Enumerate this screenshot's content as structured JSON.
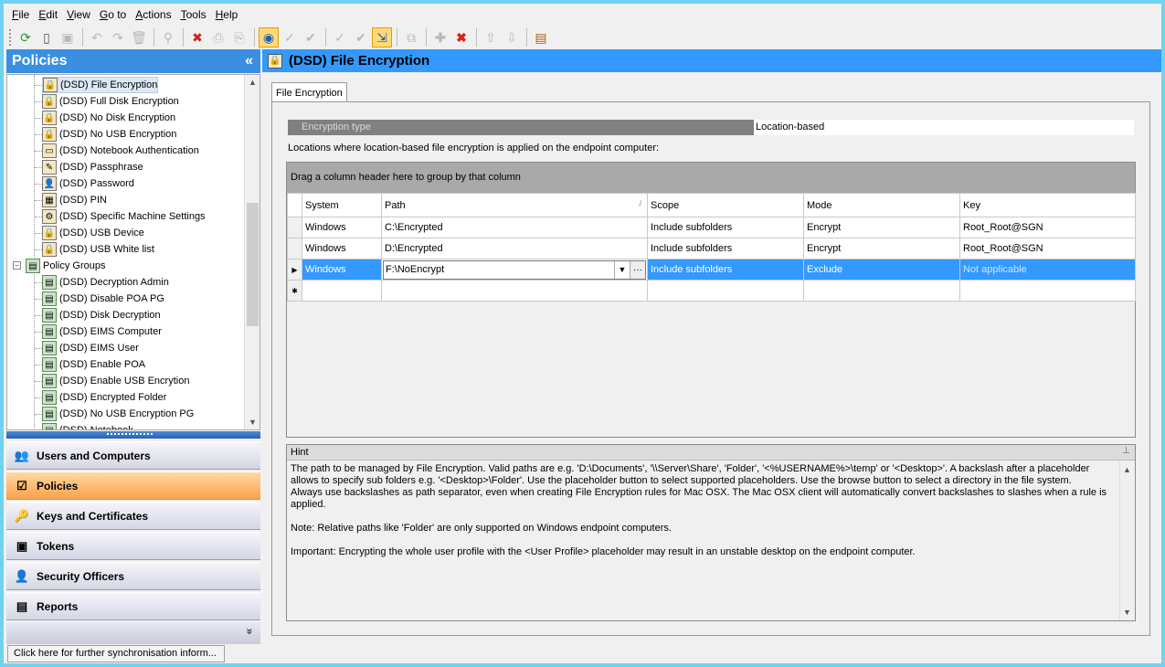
{
  "menu": [
    {
      "pre": "",
      "ul": "F",
      "post": "ile"
    },
    {
      "pre": "",
      "ul": "E",
      "post": "dit"
    },
    {
      "pre": "",
      "ul": "V",
      "post": "iew"
    },
    {
      "pre": "",
      "ul": "G",
      "post": "o to"
    },
    {
      "pre": "",
      "ul": "A",
      "post": "ctions"
    },
    {
      "pre": "",
      "ul": "T",
      "post": "ools"
    },
    {
      "pre": "",
      "ul": "H",
      "post": "elp"
    }
  ],
  "left": {
    "title": "Policies",
    "collapse_glyph": "«",
    "tree": [
      {
        "label": "(DSD) File Encryption",
        "icon": "lock-doc-icon",
        "selected": true
      },
      {
        "label": "(DSD) Full Disk Encryption",
        "icon": "lock-doc-icon"
      },
      {
        "label": "(DSD) No Disk Encryption",
        "icon": "lock-doc-icon"
      },
      {
        "label": "(DSD) No USB Encryption",
        "icon": "lock-doc-icon"
      },
      {
        "label": "(DSD) Notebook Authentication",
        "icon": "notebook-icon"
      },
      {
        "label": "(DSD) Passphrase",
        "icon": "passphrase-icon"
      },
      {
        "label": "(DSD) Password",
        "icon": "user-key-icon"
      },
      {
        "label": "(DSD) PIN",
        "icon": "pin-icon"
      },
      {
        "label": "(DSD) Specific Machine Settings",
        "icon": "machine-icon"
      },
      {
        "label": "(DSD) USB Device",
        "icon": "lock-doc-icon"
      },
      {
        "label": "(DSD) USB White list",
        "icon": "lock-doc-icon"
      },
      {
        "label": "Policy Groups",
        "icon": "policy-group-icon",
        "group": true
      },
      {
        "label": "(DSD) Decryption Admin",
        "icon": "policy-group-icon"
      },
      {
        "label": "(DSD) Disable POA PG",
        "icon": "policy-group-icon"
      },
      {
        "label": "(DSD) Disk Decryption",
        "icon": "policy-group-icon"
      },
      {
        "label": "(DSD) EIMS Computer",
        "icon": "policy-group-icon"
      },
      {
        "label": "(DSD) EIMS User",
        "icon": "policy-group-icon"
      },
      {
        "label": "(DSD) Enable POA",
        "icon": "policy-group-icon"
      },
      {
        "label": "(DSD) Enable USB Encrytion",
        "icon": "policy-group-icon"
      },
      {
        "label": "(DSD) Encrypted Folder",
        "icon": "policy-group-icon"
      },
      {
        "label": "(DSD) No USB Encryption PG",
        "icon": "policy-group-icon"
      },
      {
        "label": "(DSD) Notebook",
        "icon": "policy-group-icon"
      }
    ],
    "nav": [
      {
        "label": "Users and Computers",
        "icon": "users-icon",
        "glyph": "👥",
        "active": false
      },
      {
        "label": "Policies",
        "icon": "policy-check-icon",
        "glyph": "☑",
        "active": true
      },
      {
        "label": "Keys and Certificates",
        "icon": "keys-icon",
        "glyph": "🔑",
        "active": false
      },
      {
        "label": "Tokens",
        "icon": "token-icon",
        "glyph": "▣",
        "active": false
      },
      {
        "label": "Security Officers",
        "icon": "officer-icon",
        "glyph": "👤",
        "active": false
      },
      {
        "label": "Reports",
        "icon": "report-icon",
        "glyph": "▤",
        "active": false
      }
    ],
    "nav_more_glyph": "»"
  },
  "status": "Click here for further synchronisation inform...",
  "right": {
    "title": "(DSD) File Encryption",
    "tab": "File Encryption",
    "encryption_type_label": "Encryption type",
    "encryption_type_value": "Location-based",
    "locations_label": "Locations where location-based file encryption is applied on the endpoint computer:",
    "group_hint": "Drag a column header here to group by that column",
    "columns": [
      "System",
      "Path",
      "Scope",
      "Mode",
      "Key"
    ],
    "rows": [
      {
        "system": "Windows",
        "path": "C:\\Encrypted",
        "scope": "Include subfolders",
        "mode": "Encrypt",
        "key": "Root_Root@SGN"
      },
      {
        "system": "Windows",
        "path": "D:\\Encrypted",
        "scope": "Include subfolders",
        "mode": "Encrypt",
        "key": "Root_Root@SGN"
      },
      {
        "system": "Windows",
        "path": "F:\\NoEncrypt",
        "scope": "Include subfolders",
        "mode": "Exclude",
        "key": "Not applicable"
      }
    ],
    "hint_title": "Hint",
    "hint_text": "The path to be managed by File Encryption. Valid paths are e.g. 'D:\\Documents', '\\\\Server\\Share', 'Folder', '<%USERNAME%>\\temp' or '<Desktop>'. A backslash after a placeholder allows to specify sub folders e.g. '<Desktop>\\Folder'. Use the placeholder button to select supported placeholders. Use the browse button to select a directory in the file system.\nAlways use backslashes as path separator, even when creating File Encryption rules for Mac OSX. The Mac OSX client will automatically convert backslashes to slashes when a rule is applied.\n\nNote: Relative paths like 'Folder' are only supported on Windows endpoint computers.\n\nImportant: Encrypting the whole user profile with the <User Profile> placeholder may result in an unstable desktop on the endpoint computer."
  }
}
